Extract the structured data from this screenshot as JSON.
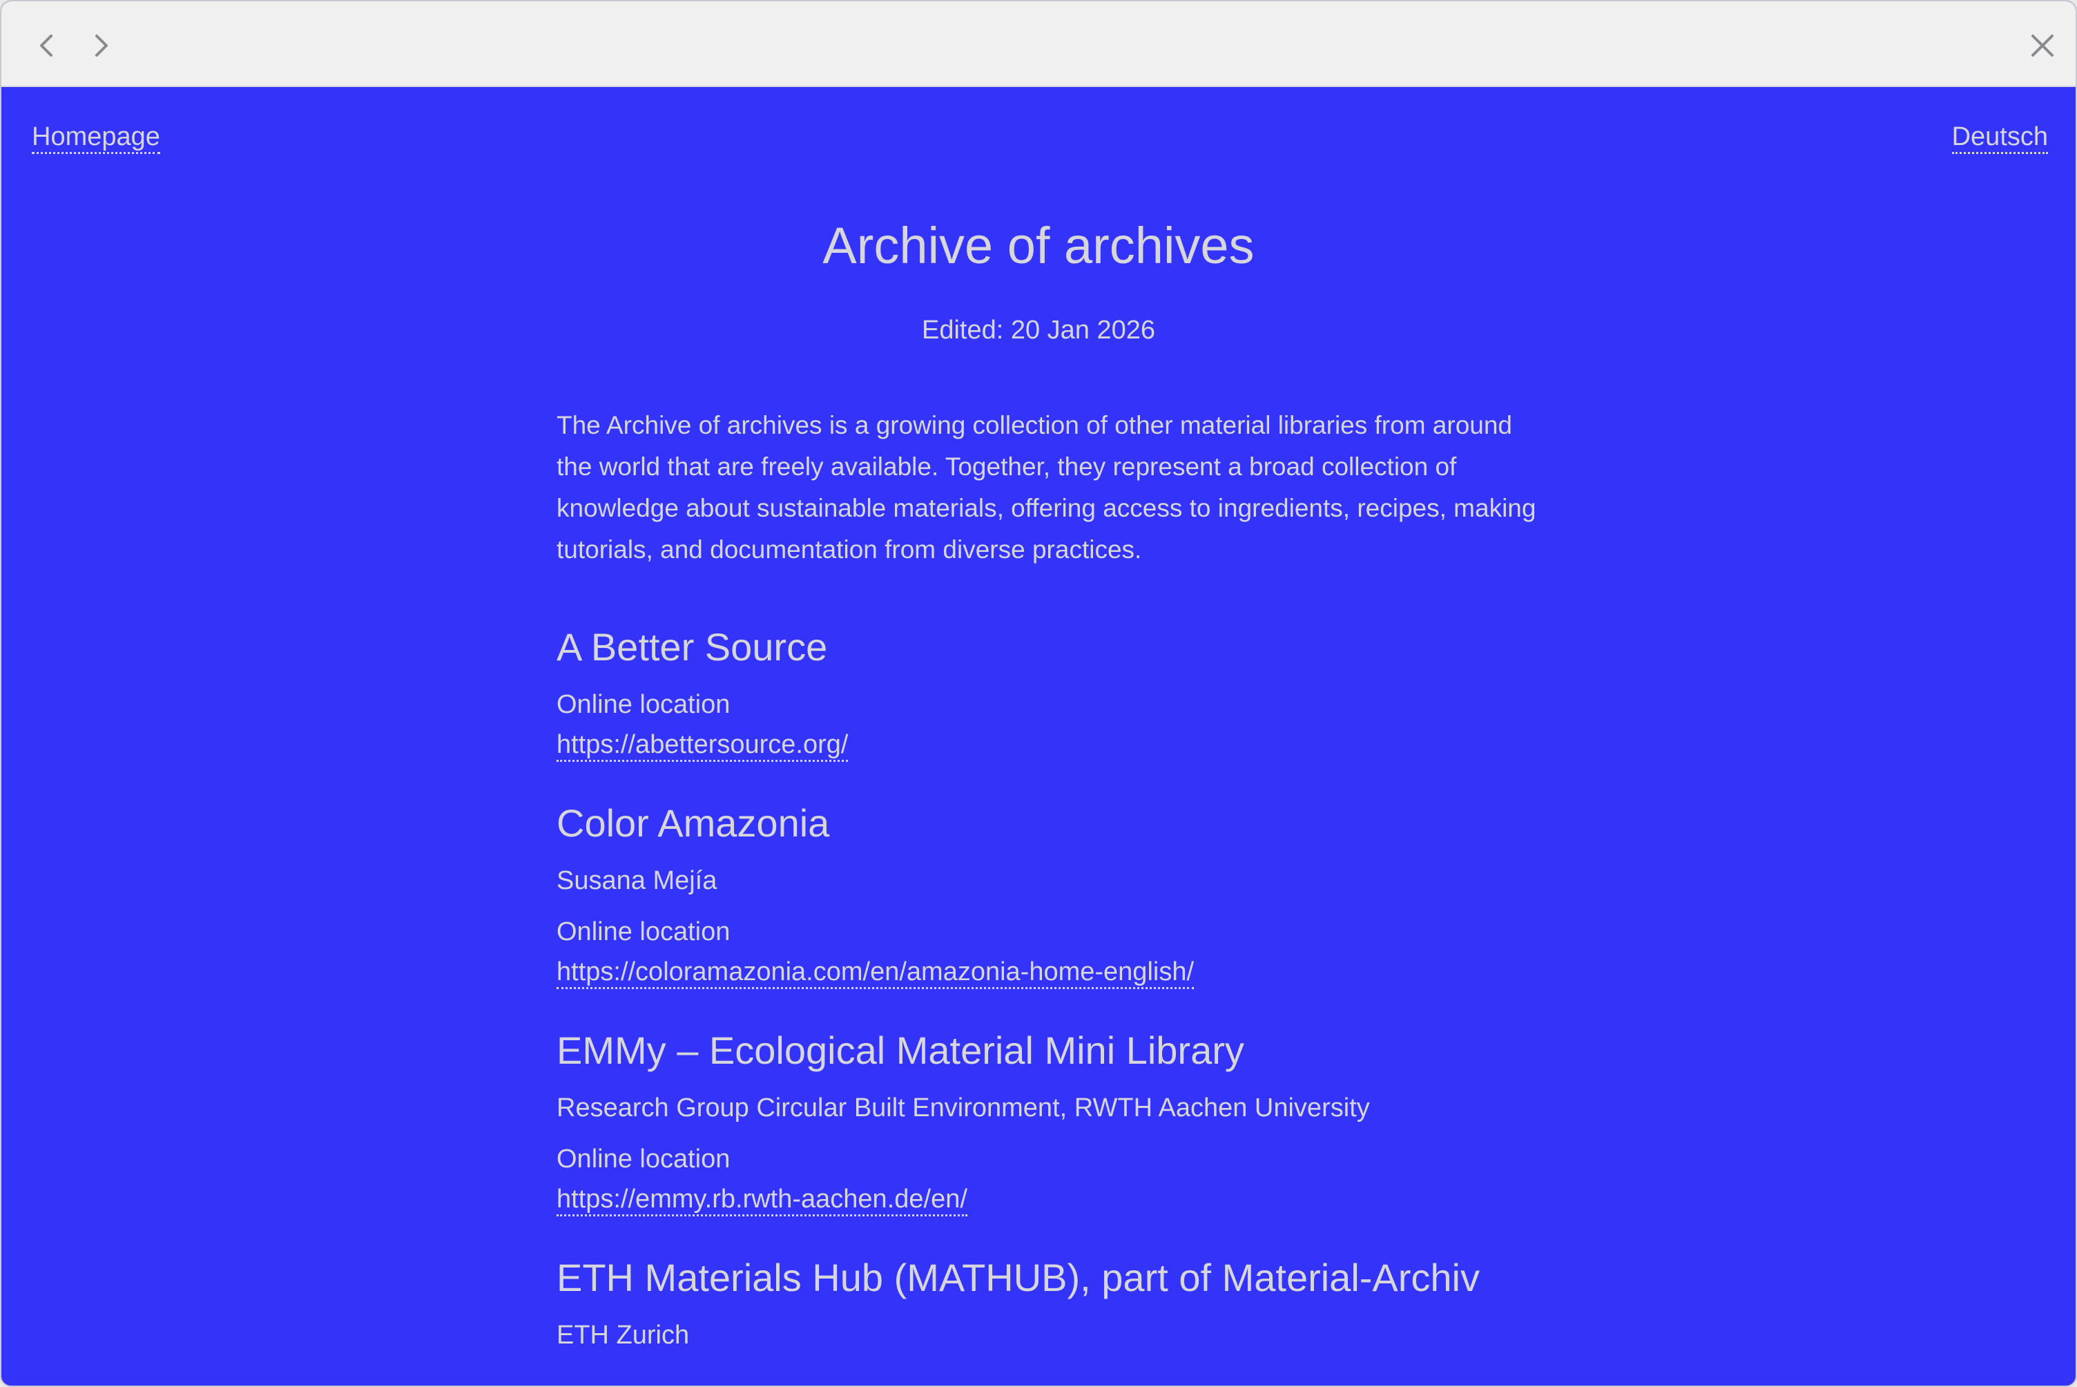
{
  "browser": {
    "back_icon": "chevron-left-icon",
    "forward_icon": "chevron-right-icon",
    "close_icon": "close-icon"
  },
  "nav": {
    "home_label": "Homepage",
    "language_label": "Deutsch"
  },
  "page": {
    "title": "Archive of archives",
    "edited": "Edited: 20 Jan 2026",
    "intro": "The Archive of archives is a growing collection of other material libraries from around the world that are freely available. Together, they represent a broad collection of knowledge about sustainable materials, offering access to ingredients, recipes, making tutorials, and documentation from diverse practices."
  },
  "entries": [
    {
      "title": "A Better Source",
      "location_label": "Online location",
      "url": "https://abettersource.org/"
    },
    {
      "title": "Color Amazonia",
      "author": "Susana Mejía",
      "location_label": "Online location",
      "url": "https://coloramazonia.com/en/amazonia-home-english/"
    },
    {
      "title": "EMMy – Ecological Material Mini Library",
      "author": "Research Group Circular Built Environment, RWTH Aachen University",
      "location_label": "Online location",
      "url": "https://emmy.rb.rwth-aachen.de/en/"
    },
    {
      "title": "ETH Materials Hub (MATHUB), part of Material-Archiv",
      "author": "ETH Zurich"
    }
  ],
  "colors": {
    "background": "#3333fa",
    "text": "#d6d6dc",
    "titlebar": "#f0f0f0"
  }
}
